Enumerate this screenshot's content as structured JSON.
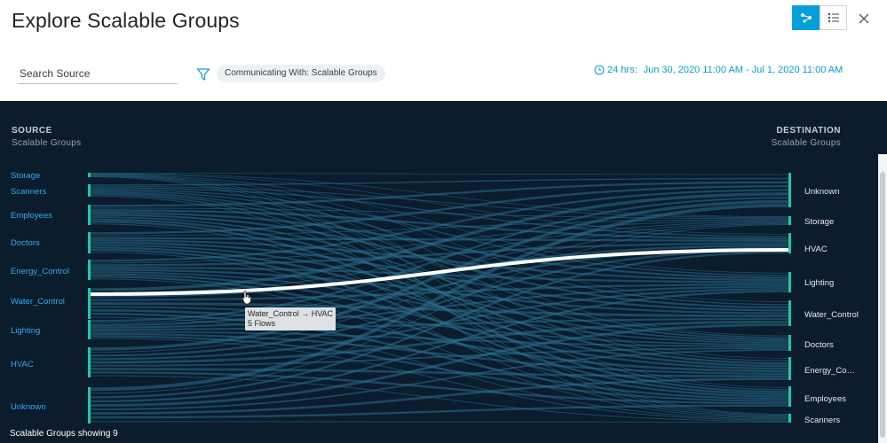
{
  "header": {
    "title": "Explore Scalable Groups",
    "view_buttons": [
      {
        "name": "graph-view-icon",
        "active": true
      },
      {
        "name": "table-view-icon",
        "active": false
      }
    ]
  },
  "filters": {
    "search_placeholder": "Search Source",
    "chip_label": "Communicating With: Scalable Groups",
    "time_prefix": "24 hrs:",
    "time_range": "Jun 30, 2020 11:00 AM - Jul 1, 2020 11:00 AM"
  },
  "diagram": {
    "source_title": "SOURCE",
    "source_subtitle": "Scalable Groups",
    "destination_title": "DESTINATION",
    "destination_subtitle": "Scalable Groups",
    "sources": [
      "Storage",
      "Scanners",
      "Employees",
      "Doctors",
      "Energy_Control",
      "Water_Control",
      "Lighting",
      "HVAC",
      "Unknown"
    ],
    "destinations": [
      "Unknown",
      "Storage",
      "HVAC",
      "Lighting",
      "Water_Control",
      "Doctors",
      "Energy_Control",
      "Employees",
      "Scanners"
    ],
    "highlight": {
      "source": "Water_Control",
      "destination": "HVAC",
      "flows": "5 Flows"
    },
    "tooltip_line1": "Water_Control → HVAC",
    "tooltip_line2": "5 Flows",
    "footer": "Scalable Groups showing 9"
  },
  "colors": {
    "accent": "#049fd9",
    "diagram_bg": "#0b1c2c",
    "flow": "#2a6f8f",
    "node_bar": "#1fc7a7"
  }
}
